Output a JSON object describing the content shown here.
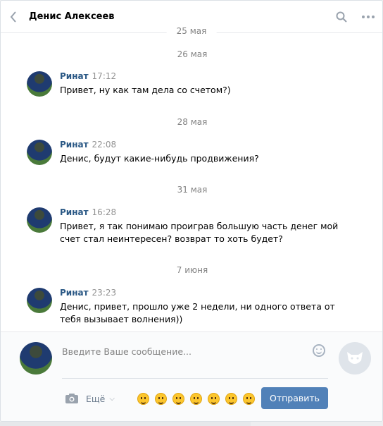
{
  "header": {
    "title": "Денис Алексеев",
    "pinned_date": "25 мая"
  },
  "feed": {
    "items": [
      {
        "date": "26 мая",
        "author": "Ринат",
        "time": "17:12",
        "text": "Привет, ну как там дела со счетом?)"
      },
      {
        "date": "28 мая",
        "author": "Ринат",
        "time": "22:08",
        "text": "Денис, будут какие-нибудь продвижения?"
      },
      {
        "date": "31 мая",
        "author": "Ринат",
        "time": "16:28",
        "text": "Привет, я так понимаю проиграв большую часть денег мой счет стал неинтересен? возврат то хоть будет?"
      },
      {
        "date": "7 июня",
        "author": "Ринат",
        "time": "23:23",
        "text": "Денис, привет, прошло уже 2 недели, ни одного ответа от тебя вызывает волнения))"
      }
    ]
  },
  "composer": {
    "placeholder": "Введите Ваше сообщение...",
    "more_label": "Ещё",
    "send_label": "Отправить",
    "emoji_names": [
      "laughing-emoji",
      "tongue-emoji",
      "scared-emoji",
      "smiling-emoji",
      "grinning-emoji",
      "neutral-emoji",
      "winking-emoji"
    ]
  },
  "colors": {
    "accent": "#5181b8",
    "author": "#2a5885",
    "muted": "#828282"
  }
}
